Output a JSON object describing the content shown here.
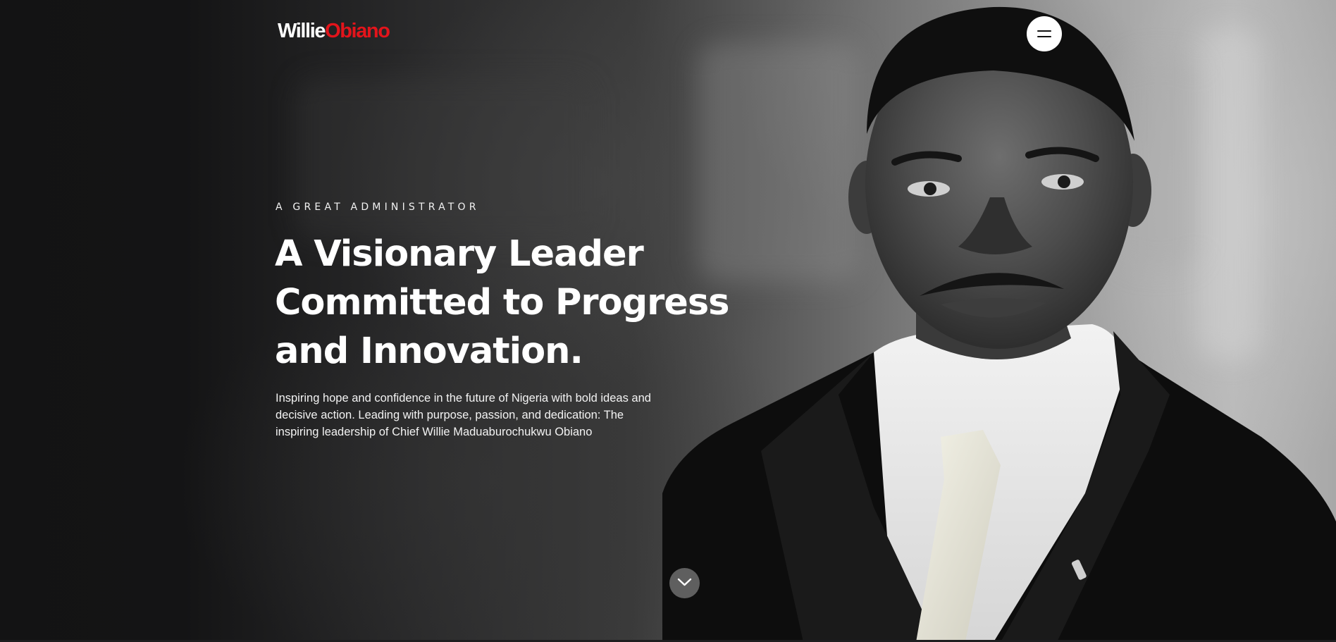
{
  "brand": {
    "first_name": "Willie",
    "last_name": "Obiano",
    "accent_color": "#e3141b"
  },
  "header": {
    "menu_icon": "hamburger-menu-icon"
  },
  "hero": {
    "eyebrow": "A GREAT ADMINISTRATOR",
    "headline_lines": [
      "A Visionary Leader",
      "Committed to Progress",
      "and Innovation."
    ],
    "lead_lines": [
      "Inspiring hope and confidence in the future of Nigeria with bold ideas and",
      "decisive action. Leading with purpose, passion, and dedication: The",
      "inspiring leadership of Chief Willie Maduaburochukwu Obiano"
    ],
    "scroll_icon": "chevron-down-icon"
  }
}
